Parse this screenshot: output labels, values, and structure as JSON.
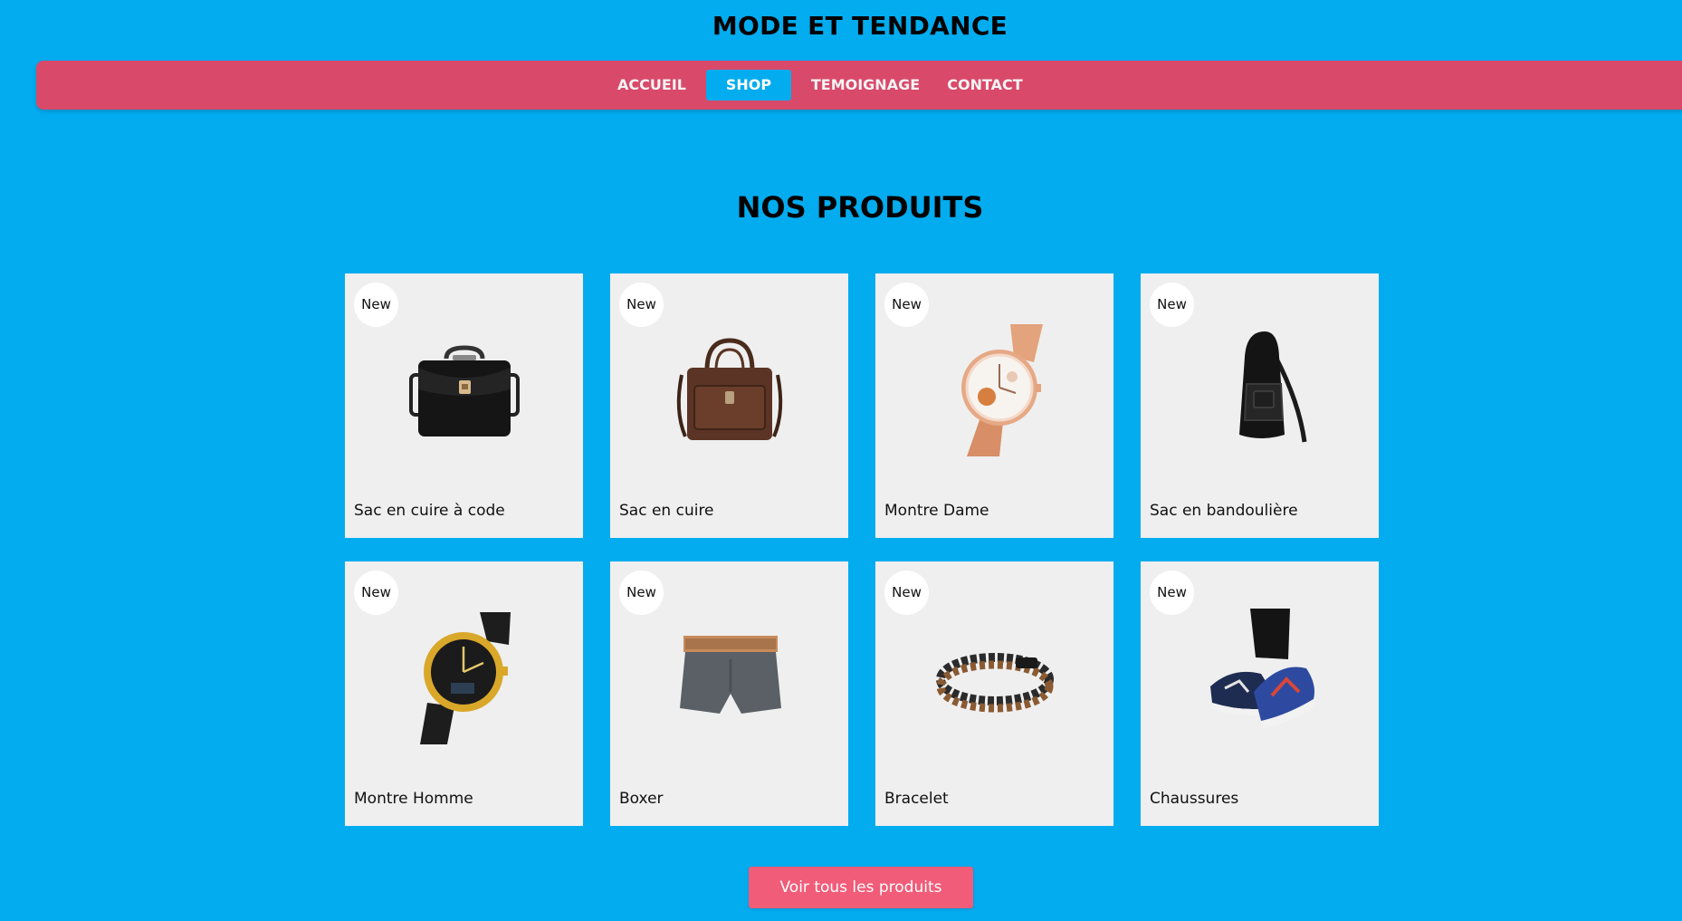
{
  "header": {
    "title": "MODE ET TENDANCE"
  },
  "nav": {
    "items": [
      {
        "label": "ACCUEIL",
        "active": false
      },
      {
        "label": "SHOP",
        "active": true
      },
      {
        "label": "TEMOIGNAGE",
        "active": false
      },
      {
        "label": "CONTACT",
        "active": false
      }
    ]
  },
  "products_section": {
    "title": "NOS PRODUITS",
    "products": [
      {
        "badge": "New",
        "name": "Sac en cuire à code",
        "image": "black-briefcase"
      },
      {
        "badge": "New",
        "name": "Sac en cuire",
        "image": "brown-leather-bag"
      },
      {
        "badge": "New",
        "name": "Montre Dame",
        "image": "rose-gold-ladies-watch"
      },
      {
        "badge": "New",
        "name": "Sac en bandoulière",
        "image": "black-sling-bag"
      },
      {
        "badge": "New",
        "name": "Montre Homme",
        "image": "gold-mens-watch"
      },
      {
        "badge": "New",
        "name": "Boxer",
        "image": "grey-boxer-shorts"
      },
      {
        "badge": "New",
        "name": "Bracelet",
        "image": "beaded-bracelet"
      },
      {
        "badge": "New",
        "name": "Chaussures",
        "image": "colorful-sneakers"
      }
    ],
    "cta_label": "Voir tous les produits"
  },
  "colors": {
    "background": "#02acef",
    "navbar": "#d9496a",
    "card": "#efefef",
    "cta": "#f15c79"
  }
}
